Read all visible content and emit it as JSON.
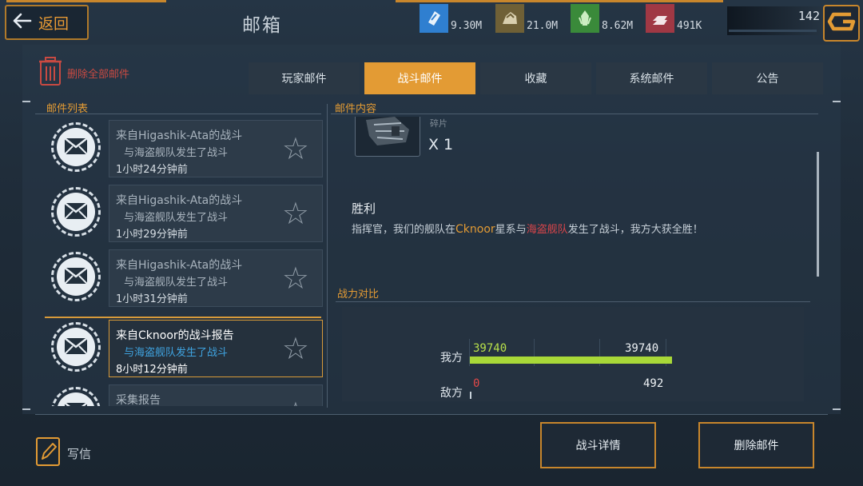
{
  "header": {
    "back_label": "返回",
    "title": "邮箱",
    "resources": [
      {
        "icon": "crystal-card-icon",
        "value": "9.30M",
        "color": "#2f7fd0"
      },
      {
        "icon": "ore-icon",
        "value": "21.0M",
        "color": "#8a7440"
      },
      {
        "icon": "green-crystal-icon",
        "value": "8.62M",
        "color": "#3a8a3a"
      },
      {
        "icon": "ingot-icon",
        "value": "491K",
        "color": "#a03844"
      }
    ],
    "power": "142"
  },
  "toolbar": {
    "delete_all_label": "删除全部邮件"
  },
  "tabs": [
    {
      "label": "玩家邮件",
      "active": false
    },
    {
      "label": "战斗邮件",
      "active": true
    },
    {
      "label": "收藏",
      "active": false
    },
    {
      "label": "系统邮件",
      "active": false
    },
    {
      "label": "公告",
      "active": false
    }
  ],
  "mail_list": {
    "title": "邮件列表",
    "items": [
      {
        "line1": "来自Higashik-Ata的战斗",
        "line2": "与海盗舰队发生了战斗",
        "time": "1小时24分钟前"
      },
      {
        "line1": "来自Higashik-Ata的战斗",
        "line2": "与海盗舰队发生了战斗",
        "time": "1小时29分钟前"
      },
      {
        "line1": "来自Higashik-Ata的战斗",
        "line2": "与海盗舰队发生了战斗",
        "time": "1小时31分钟前"
      },
      {
        "line1": "来自Cknoor的战斗报告",
        "line2": "与海盗舰队发生了战斗",
        "time": "8小时12分钟前",
        "selected": true
      },
      {
        "line1": "采集报告",
        "line2": "",
        "time": ""
      }
    ]
  },
  "content": {
    "title": "邮件内容",
    "item_label": "碎片",
    "item_qty": "X 1",
    "result": "胜利",
    "message": {
      "prefix": "指挥官，我们的舰队在",
      "system": "Cknoor",
      "mid": "星系与",
      "enemy": "海盗舰队",
      "suffix": "发生了战斗，我方大获全胜！"
    },
    "comparison": {
      "title": "战力对比",
      "ours_label": "我方",
      "enemy_label": "敌方",
      "ours_value": "39740",
      "ours_right": "39740",
      "enemy_value": "0",
      "enemy_right": "492",
      "ours_fraction": 1.0,
      "enemy_fraction": 0.0
    }
  },
  "footer": {
    "write_label": "写信",
    "battle_detail_label": "战斗详情",
    "delete_mail_label": "删除邮件"
  }
}
